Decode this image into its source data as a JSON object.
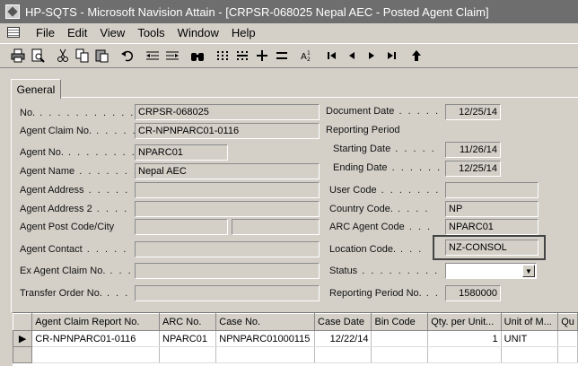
{
  "window": {
    "title": "HP-SQTS - Microsoft Navision Attain - [CRPSR-068025 Nepal AEC - Posted Agent Claim]"
  },
  "menu": [
    "File",
    "Edit",
    "View",
    "Tools",
    "Window",
    "Help"
  ],
  "toolbar": {
    "icons": [
      "print-icon",
      "print-preview-icon",
      "cut-icon",
      "copy-icon",
      "paste-icon",
      "undo-icon",
      "indent-left-icon",
      "indent-right-icon",
      "find-icon",
      "filter-grid-icon",
      "filter-field-icon",
      "add-icon",
      "list-icon",
      "sort-icon",
      "first-record-icon",
      "previous-record-icon",
      "next-record-icon",
      "last-record-icon",
      "up-icon"
    ]
  },
  "tab": {
    "general": "General"
  },
  "left": {
    "no_label": "No.",
    "no_value": "CRPSR-068025",
    "agent_claim_no_label": "Agent Claim No.",
    "agent_claim_no_value": "CR-NPNPARC01-0116",
    "agent_no_label": "Agent No.",
    "agent_no_value": "NPARC01",
    "agent_name_label": "Agent Name",
    "agent_name_value": "Nepal AEC",
    "agent_address_label": "Agent Address",
    "agent_address_value": "",
    "agent_address2_label": "Agent Address 2",
    "agent_address2_value": "",
    "agent_post_code_label": "Agent Post Code/City",
    "agent_post_code_value": "",
    "agent_city_value": "",
    "agent_contact_label": "Agent Contact",
    "agent_contact_value": "",
    "ex_agent_claim_label": "Ex Agent Claim No.",
    "ex_agent_claim_value": "",
    "transfer_order_label": "Transfer Order No.",
    "transfer_order_value": ""
  },
  "right": {
    "document_date_label": "Document Date",
    "document_date_value": "12/25/14",
    "reporting_period_label": "Reporting Period",
    "starting_date_label": "Starting Date",
    "starting_date_value": "11/26/14",
    "ending_date_label": "Ending Date",
    "ending_date_value": "12/25/14",
    "user_code_label": "User Code",
    "user_code_value": "",
    "country_code_label": "Country Code.",
    "country_code_value": "NP",
    "arc_agent_code_label": "ARC Agent Code",
    "arc_agent_code_value": "NPARC01",
    "location_code_label": "Location Code.",
    "location_code_value": "NZ-CONSOL",
    "status_label": "Status",
    "status_value": "",
    "reporting_period_no_label": "Reporting Period No.",
    "reporting_period_no_value": "1580000"
  },
  "grid": {
    "headers": [
      "Agent Claim Report No.",
      "ARC No.",
      "Case No.",
      "Case Date",
      "Bin Code",
      "Qty. per Unit...",
      "Unit of M...",
      "Qu"
    ],
    "rows": [
      [
        "CR-NPNPARC01-0116",
        "NPARC01",
        "NPNPARC01000115",
        "12/22/14",
        "",
        "1",
        "UNIT",
        ""
      ]
    ]
  }
}
